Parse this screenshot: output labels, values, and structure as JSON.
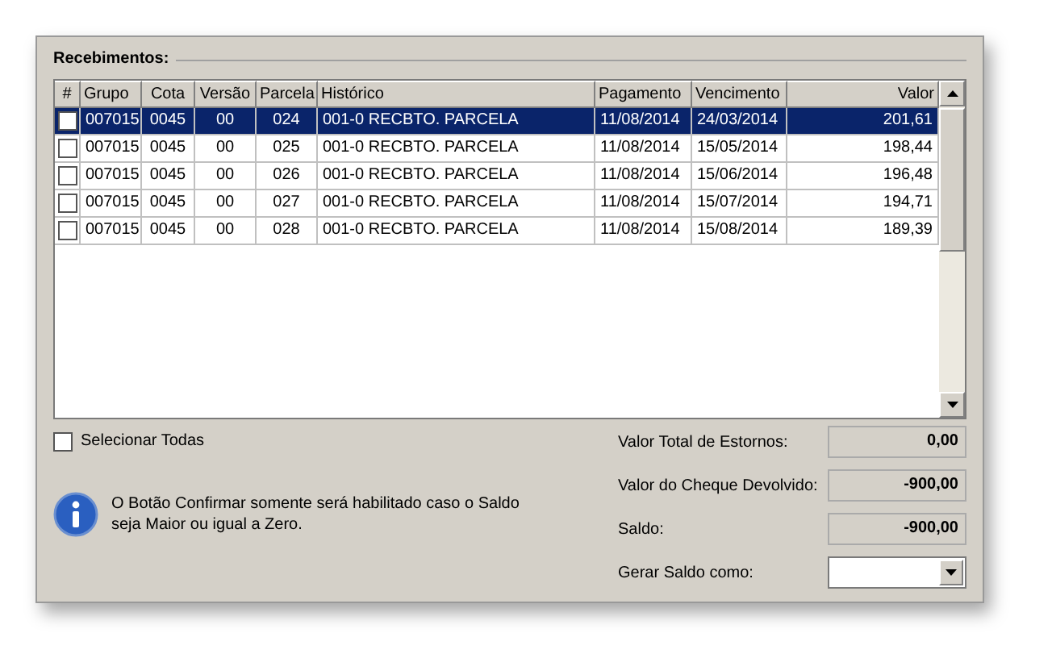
{
  "group_title": "Recebimentos:",
  "table": {
    "columns": [
      "#",
      "Grupo",
      "Cota",
      "Versão",
      "Parcela",
      "Histórico",
      "Pagamento",
      "Vencimento",
      "Valor"
    ],
    "rows": [
      {
        "checked": false,
        "selected": true,
        "cells": [
          "",
          "007015",
          "0045",
          "00",
          "024",
          "001-0 RECBTO. PARCELA",
          "11/08/2014",
          "24/03/2014",
          "201,61"
        ]
      },
      {
        "checked": false,
        "selected": false,
        "cells": [
          "",
          "007015",
          "0045",
          "00",
          "025",
          "001-0 RECBTO. PARCELA",
          "11/08/2014",
          "15/05/2014",
          "198,44"
        ]
      },
      {
        "checked": false,
        "selected": false,
        "cells": [
          "",
          "007015",
          "0045",
          "00",
          "026",
          "001-0 RECBTO. PARCELA",
          "11/08/2014",
          "15/06/2014",
          "196,48"
        ]
      },
      {
        "checked": false,
        "selected": false,
        "cells": [
          "",
          "007015",
          "0045",
          "00",
          "027",
          "001-0 RECBTO. PARCELA",
          "11/08/2014",
          "15/07/2014",
          "194,71"
        ]
      },
      {
        "checked": false,
        "selected": false,
        "cells": [
          "",
          "007015",
          "0045",
          "00",
          "028",
          "001-0 RECBTO. PARCELA",
          "11/08/2014",
          "15/08/2014",
          "189,39"
        ]
      }
    ]
  },
  "select_all": {
    "label": "Selecionar Todas",
    "checked": false
  },
  "info_message": "O Botão Confirmar somente será habilitado caso o Saldo seja Maior ou igual a Zero.",
  "totals": [
    {
      "kind": "readout",
      "label": "Valor Total de Estornos:",
      "value": "0,00"
    },
    {
      "kind": "readout",
      "label": "Valor do Cheque Devolvido:",
      "value": "-900,00"
    },
    {
      "kind": "readout",
      "label": "Saldo:",
      "value": "-900,00"
    },
    {
      "kind": "dropdown",
      "label": "Gerar Saldo como:"
    }
  ]
}
